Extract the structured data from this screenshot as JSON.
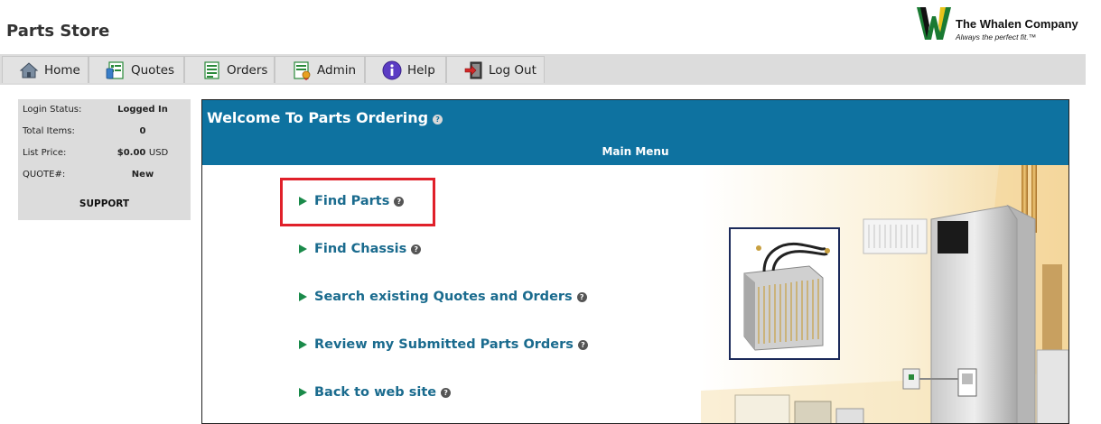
{
  "header": {
    "app_title": "Parts Store",
    "logo_name": "The Whalen Company",
    "logo_tagline": "Always the perfect fit.™"
  },
  "nav": {
    "items": [
      {
        "label": "Home",
        "icon": "home-icon"
      },
      {
        "label": "Quotes",
        "icon": "quotes-icon"
      },
      {
        "label": "Orders",
        "icon": "orders-icon"
      },
      {
        "label": "Admin",
        "icon": "admin-icon"
      },
      {
        "label": "Help",
        "icon": "help-icon"
      },
      {
        "label": "Log Out",
        "icon": "logout-icon"
      }
    ]
  },
  "status": {
    "login_label": "Login Status:",
    "login_value": "Logged In",
    "items_label": "Total Items:",
    "items_value": "0",
    "price_label": "List Price:",
    "price_value": "$0.00",
    "price_unit": "USD",
    "quote_label": "QUOTE#:",
    "quote_value": "New",
    "support": "SUPPORT"
  },
  "main": {
    "title": "Welcome To Parts Ordering",
    "menu_header": "Main Menu",
    "help_glyph": "?",
    "links": [
      {
        "label": "Find Parts"
      },
      {
        "label": "Find Chassis"
      },
      {
        "label": "Search existing Quotes and Orders"
      },
      {
        "label": "Review my Submitted Parts Orders"
      },
      {
        "label": "Back to web site"
      }
    ]
  },
  "colors": {
    "banner": "#0e72a0",
    "link": "#1a6b8e",
    "highlight": "#e0202a",
    "navbar": "#dcdcdc"
  }
}
